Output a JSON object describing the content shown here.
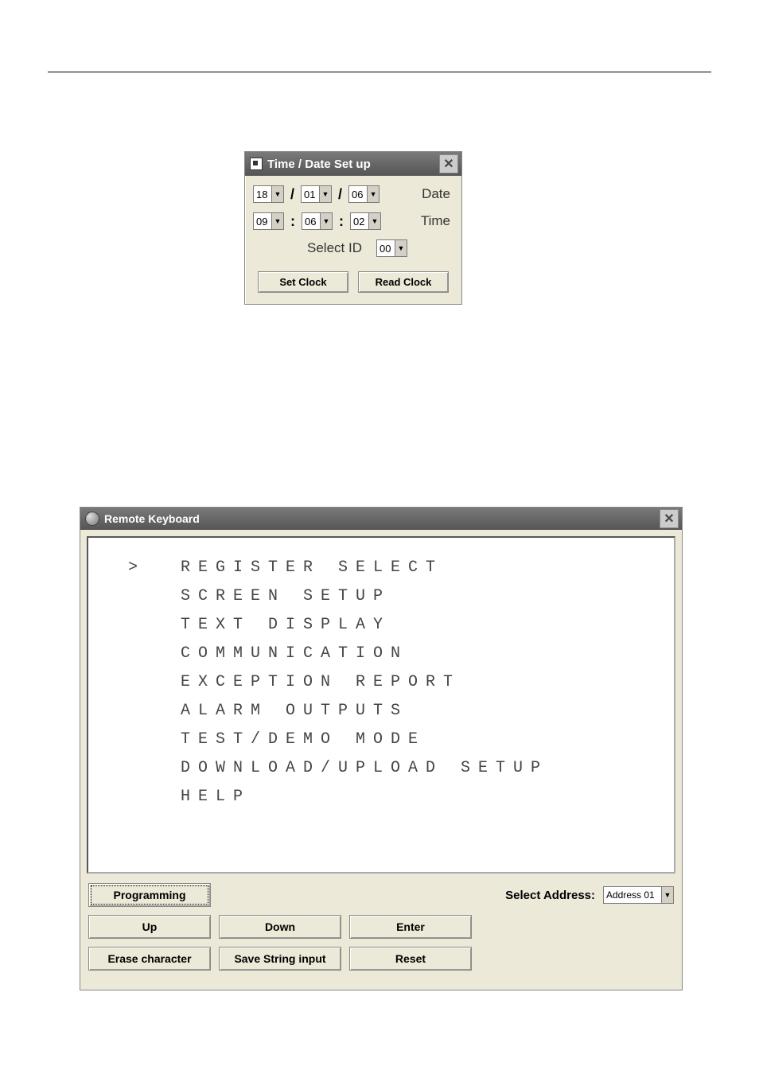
{
  "time_date_window": {
    "title": "Time / Date Set up",
    "date": {
      "day": "18",
      "month": "01",
      "year": "06",
      "label": "Date",
      "sep": "/"
    },
    "time": {
      "hour": "09",
      "minute": "06",
      "second": "02",
      "label": "Time",
      "sep": ":"
    },
    "select_id": {
      "label": "Select ID",
      "value": "00"
    },
    "buttons": {
      "set_clock": "Set Clock",
      "read_clock": "Read Clock"
    }
  },
  "remote_keyboard_window": {
    "title": "Remote Keyboard",
    "menu_items": [
      "REGISTER SELECT",
      "SCREEN SETUP",
      "TEXT DISPLAY",
      "COMMUNICATION",
      "EXCEPTION REPORT",
      "ALARM OUTPUTS",
      "TEST/DEMO MODE",
      "DOWNLOAD/UPLOAD SETUP",
      "HELP"
    ],
    "cursor": ">",
    "selected_index": 0,
    "select_address": {
      "label": "Select Address:",
      "value": "Address 01"
    },
    "buttons": {
      "programming": "Programming",
      "up": "Up",
      "down": "Down",
      "enter": "Enter",
      "erase": "Erase character",
      "save": "Save String input",
      "reset": "Reset"
    }
  }
}
